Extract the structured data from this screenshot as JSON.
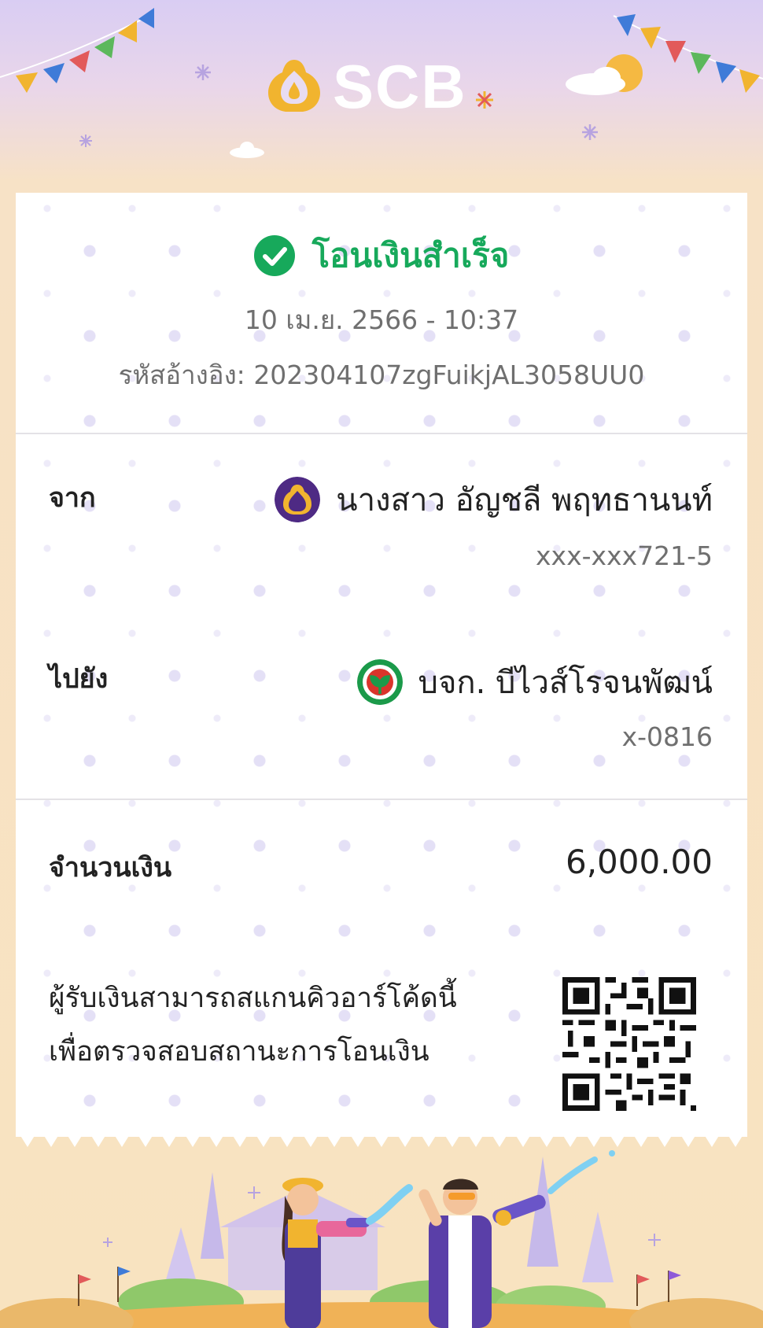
{
  "app": {
    "brand": "SCB"
  },
  "colors": {
    "success": "#17a95b",
    "brand_purple": "#4e2a84",
    "brand_gold": "#f1b42f",
    "kbank_green": "#1b9a4a"
  },
  "receipt": {
    "status": "โอนเงินสำเร็จ",
    "status_icon": "check-circle-icon",
    "datetime": "10 เม.ย. 2566 - 10:37",
    "ref_label": "รหัสอ้างอิง:",
    "ref_value": "202304107zgFuikjAL3058UU0"
  },
  "from": {
    "label": "จาก",
    "name": "นางสาว อัญชลี พฤทธานนท์",
    "account": "xxx-xxx721-5",
    "bank_icon": "scb-logo-icon"
  },
  "to": {
    "label": "ไปยัง",
    "name": "บจก. บีไวส์โรจนพัฒน์",
    "account": "x-0816",
    "bank_icon": "kbank-logo-icon"
  },
  "amount": {
    "label": "จำนวนเงิน",
    "value": "6,000.00"
  },
  "qr": {
    "note_line1": "ผู้รับเงินสามารถสแกนคิวอาร์โค้ดนี้",
    "note_line2": "เพื่อตรวจสอบสถานะการโอนเงิน",
    "icon": "qr-code-icon"
  }
}
